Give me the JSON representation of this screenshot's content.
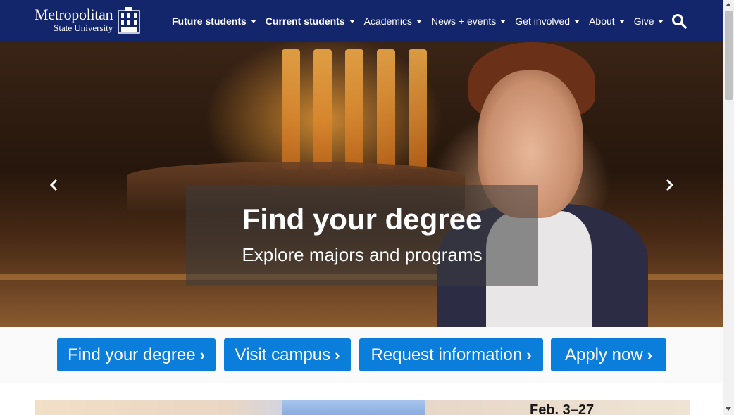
{
  "header": {
    "logo": {
      "title": "Metropolitan",
      "subtitle": "State University"
    },
    "nav": [
      {
        "label": "Future students",
        "bold": true
      },
      {
        "label": "Current students",
        "bold": true
      },
      {
        "label": "Academics",
        "bold": false
      },
      {
        "label": "News + events",
        "bold": false
      },
      {
        "label": "Get involved",
        "bold": false
      },
      {
        "label": "About",
        "bold": false
      },
      {
        "label": "Give",
        "bold": false
      }
    ],
    "search_icon": "search-icon"
  },
  "hero": {
    "title": "Find your degree",
    "subtitle": "Explore majors and programs",
    "prev_icon": "chevron-left-icon",
    "next_icon": "chevron-right-icon"
  },
  "cta": [
    {
      "label": "Find your degree",
      "icon": "chevron-right-icon"
    },
    {
      "label": "Visit campus",
      "icon": "chevron-right-icon"
    },
    {
      "label": "Request information",
      "icon": "chevron-right-icon"
    },
    {
      "label": "Apply now",
      "icon": "chevron-right-icon"
    }
  ],
  "banner": {
    "date_text": "Feb. 3–27"
  },
  "colors": {
    "navbar": "#14266b",
    "cta_button": "#0b7dda",
    "cta_bar": "#fafafa"
  }
}
